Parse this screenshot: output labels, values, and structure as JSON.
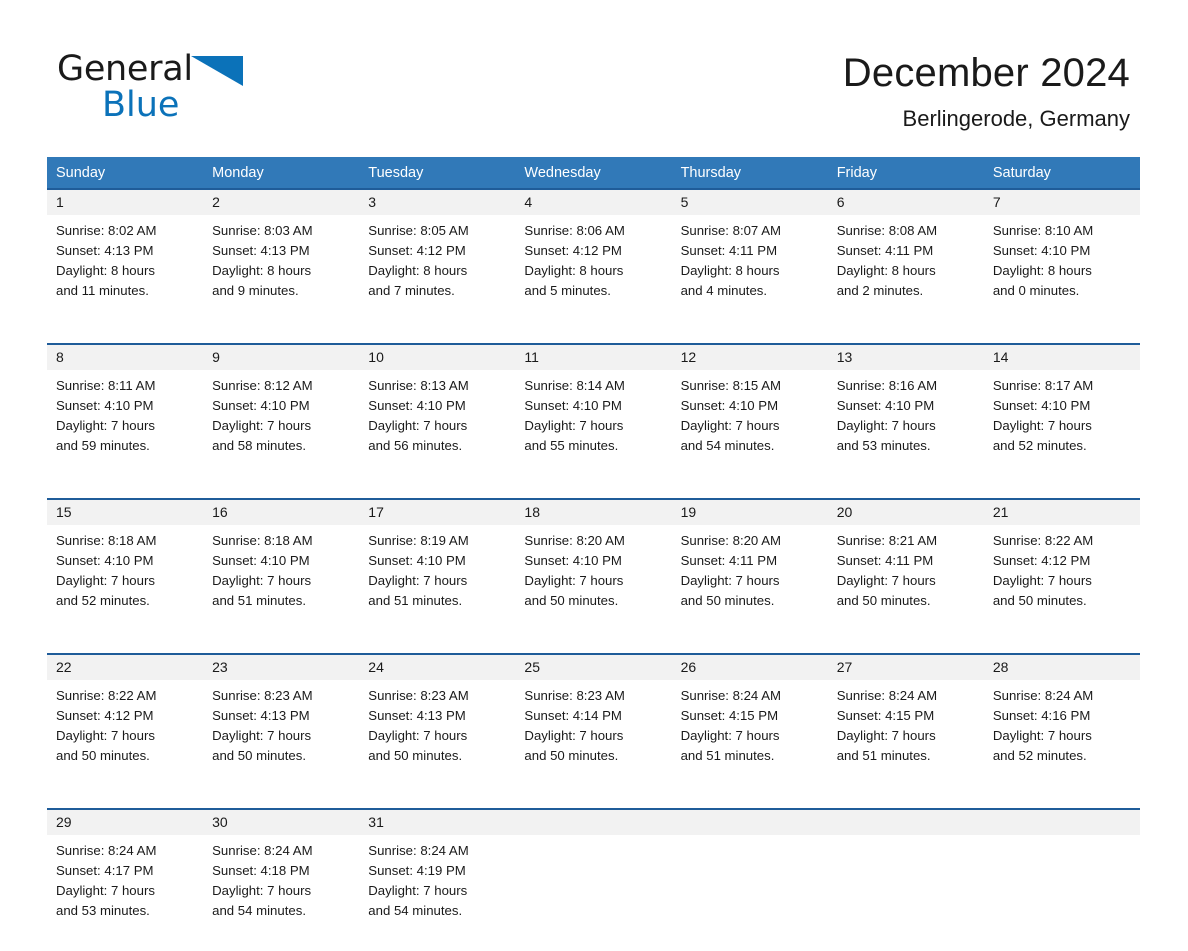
{
  "brand": {
    "word_one": "General",
    "word_two": "Blue",
    "triangle_color": "#0b72b9",
    "text_color": "#1a1a1a"
  },
  "header": {
    "title": "December 2024",
    "location": "Berlingerode, Germany"
  },
  "theme": {
    "header_blue": "#3179b8",
    "row_rule_blue": "#1f5c99",
    "date_band_gray": "#f2f2f2",
    "page_background": "#ffffff"
  },
  "calendar": {
    "day_names": [
      "Sunday",
      "Monday",
      "Tuesday",
      "Wednesday",
      "Thursday",
      "Friday",
      "Saturday"
    ],
    "weeks": [
      [
        {
          "day": "1",
          "sunrise": "Sunrise: 8:02 AM",
          "sunset": "Sunset: 4:13 PM",
          "daylight_line1": "Daylight: 8 hours",
          "daylight_line2": "and 11 minutes."
        },
        {
          "day": "2",
          "sunrise": "Sunrise: 8:03 AM",
          "sunset": "Sunset: 4:13 PM",
          "daylight_line1": "Daylight: 8 hours",
          "daylight_line2": "and 9 minutes."
        },
        {
          "day": "3",
          "sunrise": "Sunrise: 8:05 AM",
          "sunset": "Sunset: 4:12 PM",
          "daylight_line1": "Daylight: 8 hours",
          "daylight_line2": "and 7 minutes."
        },
        {
          "day": "4",
          "sunrise": "Sunrise: 8:06 AM",
          "sunset": "Sunset: 4:12 PM",
          "daylight_line1": "Daylight: 8 hours",
          "daylight_line2": "and 5 minutes."
        },
        {
          "day": "5",
          "sunrise": "Sunrise: 8:07 AM",
          "sunset": "Sunset: 4:11 PM",
          "daylight_line1": "Daylight: 8 hours",
          "daylight_line2": "and 4 minutes."
        },
        {
          "day": "6",
          "sunrise": "Sunrise: 8:08 AM",
          "sunset": "Sunset: 4:11 PM",
          "daylight_line1": "Daylight: 8 hours",
          "daylight_line2": "and 2 minutes."
        },
        {
          "day": "7",
          "sunrise": "Sunrise: 8:10 AM",
          "sunset": "Sunset: 4:10 PM",
          "daylight_line1": "Daylight: 8 hours",
          "daylight_line2": "and 0 minutes."
        }
      ],
      [
        {
          "day": "8",
          "sunrise": "Sunrise: 8:11 AM",
          "sunset": "Sunset: 4:10 PM",
          "daylight_line1": "Daylight: 7 hours",
          "daylight_line2": "and 59 minutes."
        },
        {
          "day": "9",
          "sunrise": "Sunrise: 8:12 AM",
          "sunset": "Sunset: 4:10 PM",
          "daylight_line1": "Daylight: 7 hours",
          "daylight_line2": "and 58 minutes."
        },
        {
          "day": "10",
          "sunrise": "Sunrise: 8:13 AM",
          "sunset": "Sunset: 4:10 PM",
          "daylight_line1": "Daylight: 7 hours",
          "daylight_line2": "and 56 minutes."
        },
        {
          "day": "11",
          "sunrise": "Sunrise: 8:14 AM",
          "sunset": "Sunset: 4:10 PM",
          "daylight_line1": "Daylight: 7 hours",
          "daylight_line2": "and 55 minutes."
        },
        {
          "day": "12",
          "sunrise": "Sunrise: 8:15 AM",
          "sunset": "Sunset: 4:10 PM",
          "daylight_line1": "Daylight: 7 hours",
          "daylight_line2": "and 54 minutes."
        },
        {
          "day": "13",
          "sunrise": "Sunrise: 8:16 AM",
          "sunset": "Sunset: 4:10 PM",
          "daylight_line1": "Daylight: 7 hours",
          "daylight_line2": "and 53 minutes."
        },
        {
          "day": "14",
          "sunrise": "Sunrise: 8:17 AM",
          "sunset": "Sunset: 4:10 PM",
          "daylight_line1": "Daylight: 7 hours",
          "daylight_line2": "and 52 minutes."
        }
      ],
      [
        {
          "day": "15",
          "sunrise": "Sunrise: 8:18 AM",
          "sunset": "Sunset: 4:10 PM",
          "daylight_line1": "Daylight: 7 hours",
          "daylight_line2": "and 52 minutes."
        },
        {
          "day": "16",
          "sunrise": "Sunrise: 8:18 AM",
          "sunset": "Sunset: 4:10 PM",
          "daylight_line1": "Daylight: 7 hours",
          "daylight_line2": "and 51 minutes."
        },
        {
          "day": "17",
          "sunrise": "Sunrise: 8:19 AM",
          "sunset": "Sunset: 4:10 PM",
          "daylight_line1": "Daylight: 7 hours",
          "daylight_line2": "and 51 minutes."
        },
        {
          "day": "18",
          "sunrise": "Sunrise: 8:20 AM",
          "sunset": "Sunset: 4:10 PM",
          "daylight_line1": "Daylight: 7 hours",
          "daylight_line2": "and 50 minutes."
        },
        {
          "day": "19",
          "sunrise": "Sunrise: 8:20 AM",
          "sunset": "Sunset: 4:11 PM",
          "daylight_line1": "Daylight: 7 hours",
          "daylight_line2": "and 50 minutes."
        },
        {
          "day": "20",
          "sunrise": "Sunrise: 8:21 AM",
          "sunset": "Sunset: 4:11 PM",
          "daylight_line1": "Daylight: 7 hours",
          "daylight_line2": "and 50 minutes."
        },
        {
          "day": "21",
          "sunrise": "Sunrise: 8:22 AM",
          "sunset": "Sunset: 4:12 PM",
          "daylight_line1": "Daylight: 7 hours",
          "daylight_line2": "and 50 minutes."
        }
      ],
      [
        {
          "day": "22",
          "sunrise": "Sunrise: 8:22 AM",
          "sunset": "Sunset: 4:12 PM",
          "daylight_line1": "Daylight: 7 hours",
          "daylight_line2": "and 50 minutes."
        },
        {
          "day": "23",
          "sunrise": "Sunrise: 8:23 AM",
          "sunset": "Sunset: 4:13 PM",
          "daylight_line1": "Daylight: 7 hours",
          "daylight_line2": "and 50 minutes."
        },
        {
          "day": "24",
          "sunrise": "Sunrise: 8:23 AM",
          "sunset": "Sunset: 4:13 PM",
          "daylight_line1": "Daylight: 7 hours",
          "daylight_line2": "and 50 minutes."
        },
        {
          "day": "25",
          "sunrise": "Sunrise: 8:23 AM",
          "sunset": "Sunset: 4:14 PM",
          "daylight_line1": "Daylight: 7 hours",
          "daylight_line2": "and 50 minutes."
        },
        {
          "day": "26",
          "sunrise": "Sunrise: 8:24 AM",
          "sunset": "Sunset: 4:15 PM",
          "daylight_line1": "Daylight: 7 hours",
          "daylight_line2": "and 51 minutes."
        },
        {
          "day": "27",
          "sunrise": "Sunrise: 8:24 AM",
          "sunset": "Sunset: 4:15 PM",
          "daylight_line1": "Daylight: 7 hours",
          "daylight_line2": "and 51 minutes."
        },
        {
          "day": "28",
          "sunrise": "Sunrise: 8:24 AM",
          "sunset": "Sunset: 4:16 PM",
          "daylight_line1": "Daylight: 7 hours",
          "daylight_line2": "and 52 minutes."
        }
      ],
      [
        {
          "day": "29",
          "sunrise": "Sunrise: 8:24 AM",
          "sunset": "Sunset: 4:17 PM",
          "daylight_line1": "Daylight: 7 hours",
          "daylight_line2": "and 53 minutes."
        },
        {
          "day": "30",
          "sunrise": "Sunrise: 8:24 AM",
          "sunset": "Sunset: 4:18 PM",
          "daylight_line1": "Daylight: 7 hours",
          "daylight_line2": "and 54 minutes."
        },
        {
          "day": "31",
          "sunrise": "Sunrise: 8:24 AM",
          "sunset": "Sunset: 4:19 PM",
          "daylight_line1": "Daylight: 7 hours",
          "daylight_line2": "and 54 minutes."
        },
        {
          "day": "",
          "sunrise": "",
          "sunset": "",
          "daylight_line1": "",
          "daylight_line2": ""
        },
        {
          "day": "",
          "sunrise": "",
          "sunset": "",
          "daylight_line1": "",
          "daylight_line2": ""
        },
        {
          "day": "",
          "sunrise": "",
          "sunset": "",
          "daylight_line1": "",
          "daylight_line2": ""
        },
        {
          "day": "",
          "sunrise": "",
          "sunset": "",
          "daylight_line1": "",
          "daylight_line2": ""
        }
      ]
    ]
  }
}
